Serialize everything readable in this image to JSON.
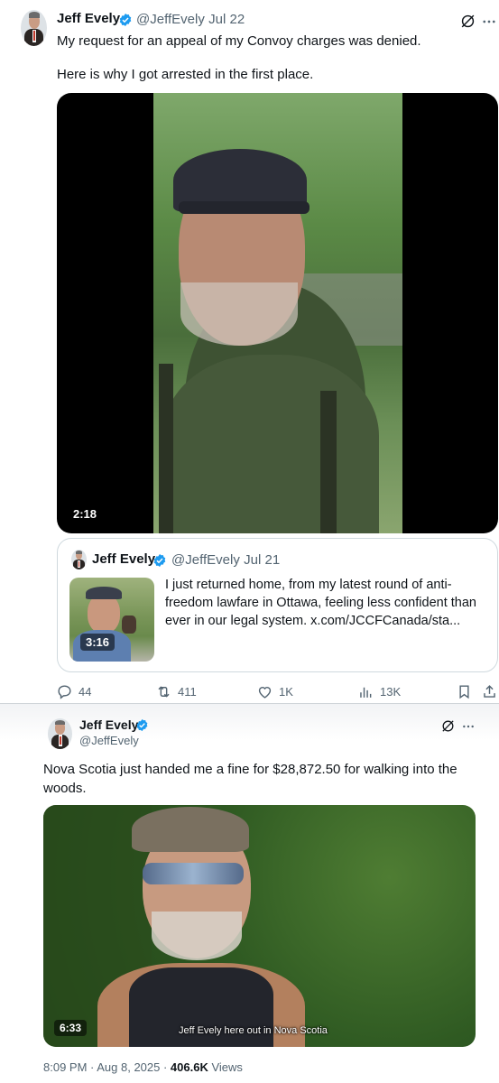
{
  "tweet1": {
    "author": {
      "name": "Jeff Evely",
      "handle": "@JeffEvely",
      "date": "· Jul 22"
    },
    "text_line1": "My request for an appeal of my Convoy charges was denied.",
    "text_line2": "Here is why I got arrested in the first place.",
    "video": {
      "duration": "2:18"
    },
    "quote": {
      "author": {
        "name": "Jeff Evely",
        "handle": "@JeffEvely",
        "date": "· Jul 21"
      },
      "lines": [
        "I just returned home, from my latest round of anti-",
        "freedom lawfare in Ottawa, feeling less confident than",
        "ever in our legal system.  x.com/JCCFCanada/sta..."
      ],
      "video_duration": "3:16"
    },
    "actions": {
      "replies": "44",
      "reposts": "411",
      "likes": "1K",
      "views": "13K"
    }
  },
  "tweet2": {
    "author": {
      "name": "Jeff Evely",
      "handle": "@JeffEvely"
    },
    "text_line1": "Nova Scotia just handed me a fine for $28,872.50 for walking into the",
    "text_line2": "woods.",
    "video": {
      "duration": "6:33",
      "caption": "Jeff Evely here out in Nova Scotia"
    },
    "meta": {
      "timestamp": "8:09 PM · Aug 8, 2025 · ",
      "views": "406.6K",
      "views_label": " Views"
    }
  },
  "colors": {
    "verified": "#1d9bf0",
    "muted": "#536471",
    "text": "#0f1419"
  },
  "icons": [
    "verified-badge-icon",
    "grok-icon",
    "more-icon",
    "reply-icon",
    "repost-icon",
    "like-icon",
    "views-icon",
    "bookmark-icon",
    "share-icon"
  ]
}
